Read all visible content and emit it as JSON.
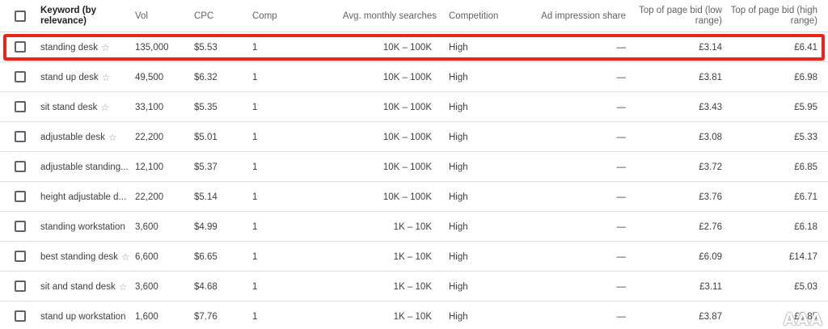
{
  "header": {
    "keyword": "Keyword (by relevance)",
    "vol": "Vol",
    "cpc": "CPC",
    "comp": "Comp",
    "avg_searches": "Avg. monthly searches",
    "competition": "Competition",
    "ad_share": "Ad impression share",
    "bid_low": "Top of page bid (low range)",
    "bid_high": "Top of page bid (high range)"
  },
  "rows": [
    {
      "keyword": "standing desk",
      "star": "☆",
      "vol": "135,000",
      "cpc": "$5.53",
      "comp": "1",
      "avg": "10K – 100K",
      "competition": "High",
      "share": "—",
      "low": "£3.14",
      "high": "£6.41"
    },
    {
      "keyword": "stand up desk",
      "star": "☆",
      "vol": "49,500",
      "cpc": "$6.32",
      "comp": "1",
      "avg": "10K – 100K",
      "competition": "High",
      "share": "—",
      "low": "£3.81",
      "high": "£6.98"
    },
    {
      "keyword": "sit stand desk",
      "star": "☆",
      "vol": "33,100",
      "cpc": "$5.35",
      "comp": "1",
      "avg": "10K – 100K",
      "competition": "High",
      "share": "—",
      "low": "£3.43",
      "high": "£5.95"
    },
    {
      "keyword": "adjustable desk",
      "star": "☆",
      "vol": "22,200",
      "cpc": "$5.01",
      "comp": "1",
      "avg": "10K – 100K",
      "competition": "High",
      "share": "—",
      "low": "£3.08",
      "high": "£5.33"
    },
    {
      "keyword": "adjustable standing...",
      "star": "",
      "vol": "12,100",
      "cpc": "$5.37",
      "comp": "1",
      "avg": "10K – 100K",
      "competition": "High",
      "share": "—",
      "low": "£3.72",
      "high": "£6.85"
    },
    {
      "keyword": "height adjustable d...",
      "star": "",
      "vol": "22,200",
      "cpc": "$5.14",
      "comp": "1",
      "avg": "10K – 100K",
      "competition": "High",
      "share": "—",
      "low": "£3.76",
      "high": "£6.71"
    },
    {
      "keyword": "standing workstation",
      "star": "",
      "vol": "3,600",
      "cpc": "$4.99",
      "comp": "1",
      "avg": "1K – 10K",
      "competition": "High",
      "share": "—",
      "low": "£2.76",
      "high": "£6.18"
    },
    {
      "keyword": "best standing desk",
      "star": "☆",
      "vol": "6,600",
      "cpc": "$6.65",
      "comp": "1",
      "avg": "1K – 10K",
      "competition": "High",
      "share": "—",
      "low": "£6.09",
      "high": "£14.17"
    },
    {
      "keyword": "sit and stand desk",
      "star": "☆",
      "vol": "3,600",
      "cpc": "$4.68",
      "comp": "1",
      "avg": "1K – 10K",
      "competition": "High",
      "share": "—",
      "low": "£3.11",
      "high": "£5.03"
    },
    {
      "keyword": "stand up workstation",
      "star": "",
      "vol": "1,600",
      "cpc": "$7.76",
      "comp": "1",
      "avg": "1K – 10K",
      "competition": "High",
      "share": "—",
      "low": "£3.87",
      "high": "£8.85"
    }
  ],
  "highlight_color": "#e8261c",
  "watermark": "AAA"
}
